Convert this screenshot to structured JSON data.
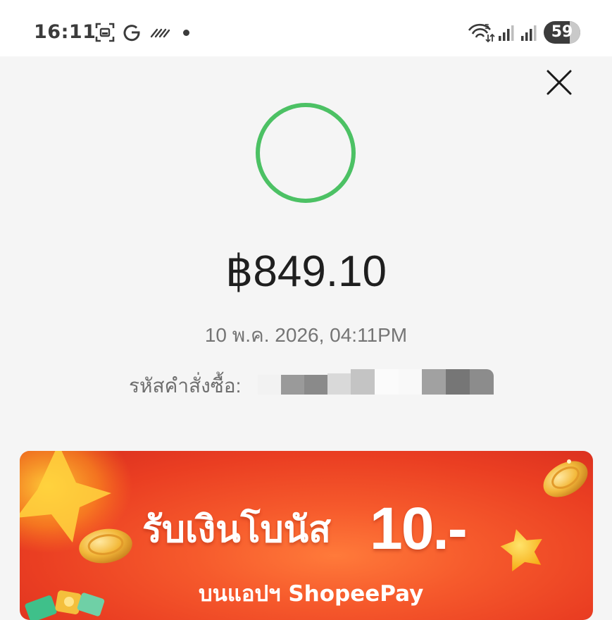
{
  "status_bar": {
    "time": "16:11",
    "battery_level": "59",
    "icons": [
      "screenshot-icon",
      "google-icon",
      "data-saver-icon",
      "notification-dot-icon",
      "wifi-5g-icon",
      "signal-icon",
      "signal-icon-2"
    ]
  },
  "header": {
    "close_icon": "close-icon"
  },
  "payment": {
    "status_icon": "success-ring-icon",
    "status_color": "#4cc164",
    "amount": "฿849.10",
    "datetime": "10 พ.ค. 2026, 04:11PM",
    "order_label": "รหัสคำสั่งซื้อ:",
    "order_value_state": "redacted"
  },
  "banner": {
    "title": "รับเงินโบนัส",
    "amount": "10.-",
    "subtitle": "บนแอปฯ ShopeePay",
    "accent_color": "#ee4d2d",
    "decor_icons": [
      "gold-coin-icon",
      "star-icon",
      "money-bills-icon"
    ]
  },
  "colors": {
    "background": "#f5f5f5",
    "amount_text": "#1f1f1f",
    "secondary_text": "#757575"
  }
}
